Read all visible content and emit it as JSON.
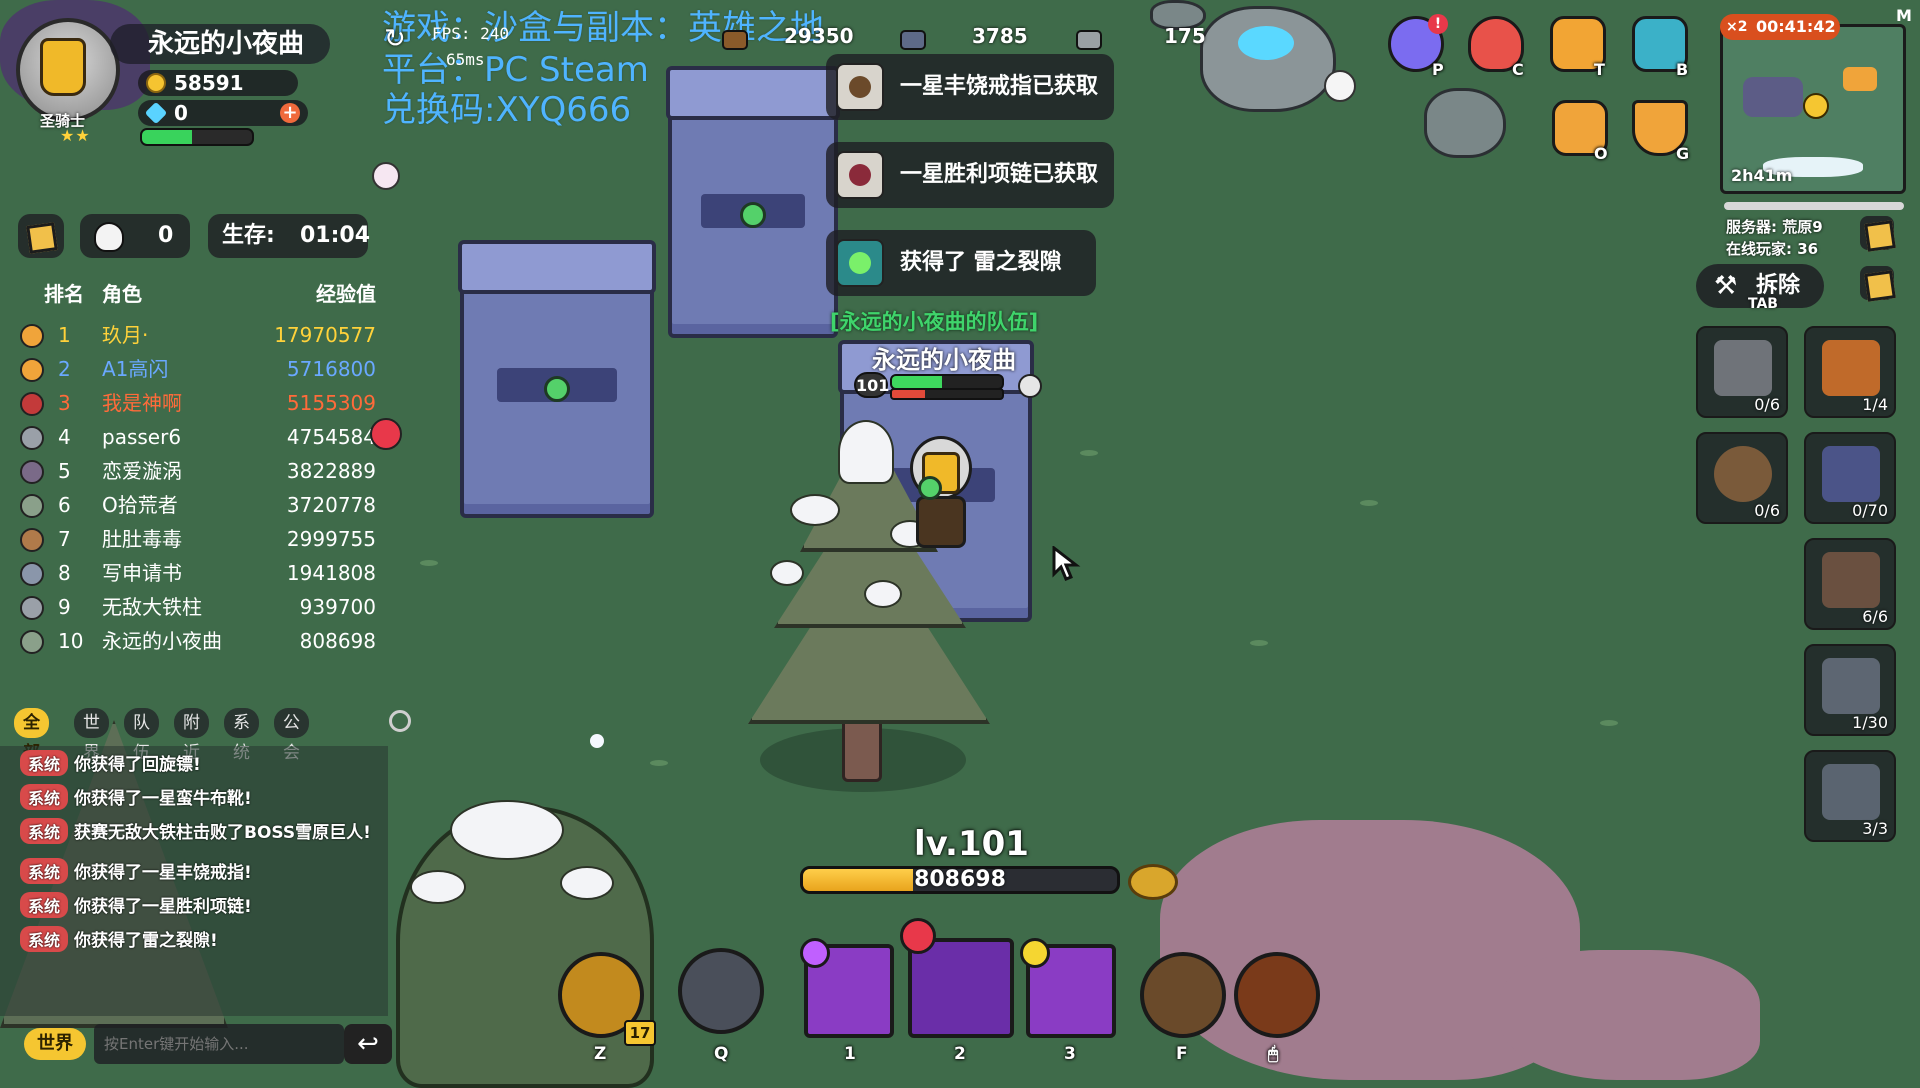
{
  "overlay": {
    "game_line": "游戏：沙盒与副本：英雄之地",
    "platform_line": "平台：PC Steam",
    "code_line": "兑换码:XYQ666",
    "fps": "FPS: 240",
    "ping": "65ms"
  },
  "player": {
    "name": "永远的小夜曲",
    "class": "圣骑士",
    "stars": "★★",
    "gold": "58591",
    "gems": "0",
    "hp_fraction": 0.45
  },
  "stats": {
    "kills": "0",
    "survive_label": "生存:",
    "survive_time": "01:04"
  },
  "leaderboard": {
    "headers": {
      "rank": "排名",
      "role": "角色",
      "exp": "经验值"
    },
    "rows": [
      {
        "rank": "1",
        "role": "玖月·",
        "exp": "17970577",
        "color": "#ffd23a"
      },
      {
        "rank": "2",
        "role": "A1高闪",
        "exp": "5716800",
        "color": "#6aa8ff"
      },
      {
        "rank": "3",
        "role": "我是神啊",
        "exp": "5155309",
        "color": "#ff6b3a"
      },
      {
        "rank": "4",
        "role": "passer6",
        "exp": "4754584",
        "color": "#ffffff"
      },
      {
        "rank": "5",
        "role": "恋爱漩涡",
        "exp": "3822889",
        "color": "#ffffff"
      },
      {
        "rank": "6",
        "role": "O拾荒者",
        "exp": "3720778",
        "color": "#ffffff"
      },
      {
        "rank": "7",
        "role": "肚肚毒毒",
        "exp": "2999755",
        "color": "#ffffff"
      },
      {
        "rank": "8",
        "role": "写申请书",
        "exp": "1941808",
        "color": "#ffffff"
      },
      {
        "rank": "9",
        "role": "无敌大铁柱",
        "exp": "939700",
        "color": "#ffffff"
      },
      {
        "rank": "10",
        "role": "永远的小夜曲",
        "exp": "808698",
        "color": "#ffffff"
      }
    ]
  },
  "chat": {
    "tabs": [
      "全部",
      "世界",
      "队伍",
      "附近",
      "系统",
      "公会"
    ],
    "active_tab": "全部",
    "messages": [
      {
        "tag": "系统",
        "text": "你获得了回旋镖!"
      },
      {
        "tag": "系统",
        "text": "你获得了一星蛮牛布靴!"
      },
      {
        "tag": "系统",
        "text": "获赛无敌大铁柱击败了BOSS雪原巨人!"
      },
      {
        "tag": "系统",
        "text": "你获得了一星丰饶戒指!"
      },
      {
        "tag": "系统",
        "text": "你获得了一星胜利项链!"
      },
      {
        "tag": "系统",
        "text": "你获得了雷之裂隙!"
      }
    ],
    "channel_button": "世界",
    "input_placeholder": "按Enter键开始输入..."
  },
  "top_resources": [
    {
      "value": "29350",
      "icon": "log-icon"
    },
    {
      "value": "3785",
      "icon": "stone-icon"
    },
    {
      "value": "175",
      "icon": "ore-icon"
    }
  ],
  "notifications": [
    {
      "text": "一星丰饶戒指已获取",
      "icon": "ring-icon"
    },
    {
      "text": "一星胜利项链已获取",
      "icon": "necklace-icon"
    },
    {
      "text": "获得了 雷之裂隙",
      "icon": "lightning-blade-icon"
    }
  ],
  "character": {
    "team_label": "[永远的小夜曲的队伍]",
    "name": "永远的小夜曲",
    "level_badge": "101",
    "hp_fraction": 0.45,
    "mp_fraction": 0.3
  },
  "menu": [
    {
      "key": "P",
      "icon": "profile-icon",
      "color": "#7b6cf0"
    },
    {
      "key": "C",
      "icon": "cat-icon",
      "color": "#e8524a"
    },
    {
      "key": "T",
      "icon": "flag-icon",
      "color": "#f2a534"
    },
    {
      "key": "B",
      "icon": "backpack-icon",
      "color": "#3bb1c8"
    },
    {
      "key": "O",
      "icon": "chest-icon",
      "color": "#f0a43a"
    },
    {
      "key": "G",
      "icon": "guild-icon",
      "color": "#f0a43a"
    }
  ],
  "minimap": {
    "timer_badge": "×2",
    "timer": "00:41:42",
    "elapsed": "2h41m",
    "corner_key": "M",
    "server": "服务器: 荒原9",
    "online": "在线玩家: 36"
  },
  "build": {
    "dismantle_label": "拆除",
    "tab_hint": "TAB",
    "slots": [
      {
        "name": "floor-tile",
        "count": "0/6",
        "color": "#6f7379"
      },
      {
        "name": "campfire",
        "count": "1/4",
        "color": "#c06a2a"
      },
      {
        "name": "trap-ring",
        "count": "0/6",
        "color": "#7a5a3a"
      },
      {
        "name": "stone-wall",
        "count": "0/70",
        "color": "#4b5488"
      },
      {
        "name": "gate",
        "count": "6/6",
        "color": "#6a5040"
      },
      {
        "name": "stone-pillar",
        "count": "1/30",
        "color": "#5d6672"
      },
      {
        "name": "storage",
        "count": "3/3",
        "color": "#5a6470"
      }
    ]
  },
  "hud": {
    "level": "lv.101",
    "xp_value": "808698",
    "xp_fraction": 0.35,
    "skills": [
      {
        "key": "Z",
        "name": "pet-skill",
        "color": "#c28a1e",
        "badge": "17"
      },
      {
        "key": "Q",
        "name": "pickaxe-skill",
        "color": "#4a4f5a"
      },
      {
        "key": "1",
        "name": "shadow-warrior-skill",
        "color": "#8a3cc4"
      },
      {
        "key": "2",
        "name": "fire-golem-skill",
        "color": "#6a2ea8"
      },
      {
        "key": "3",
        "name": "lightning-staff-skill",
        "color": "#8a3cc4"
      },
      {
        "key": "F",
        "name": "holy-sword-skill",
        "color": "#6a4a2a"
      },
      {
        "key": "🖱",
        "name": "fire-burst-skill",
        "color": "#7a3a1a"
      }
    ]
  }
}
